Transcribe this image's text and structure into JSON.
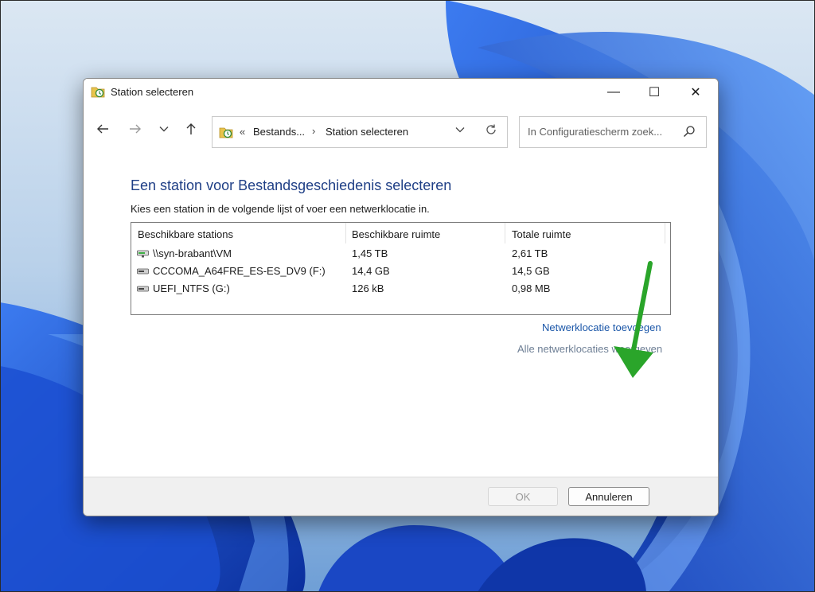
{
  "window": {
    "title": "Station selecteren",
    "controls": {
      "minimize": "—",
      "maximize": "☐",
      "close": "✕"
    }
  },
  "navigation": {
    "back_icon": "arrow-left",
    "forward_icon": "arrow-right",
    "recent_icon": "chevron-down",
    "up_icon": "arrow-up",
    "address": {
      "overflow": "«",
      "crumbs": [
        "Bestands...",
        "Station selecteren"
      ],
      "separator": "›"
    },
    "search": {
      "placeholder": "In Configuratiescherm zoek..."
    }
  },
  "content": {
    "heading": "Een station voor Bestandsgeschiedenis selecteren",
    "instruction": "Kies een station in de volgende lijst of voer een netwerklocatie in.",
    "columns": [
      "Beschikbare stations",
      "Beschikbare ruimte",
      "Totale ruimte"
    ],
    "drives": [
      {
        "name": "\\\\syn-brabant\\VM",
        "available": "1,45 TB",
        "total": "2,61 TB",
        "icon": "network-drive-icon"
      },
      {
        "name": "CCCOMA_A64FRE_ES-ES_DV9 (F:)",
        "available": "14,4 GB",
        "total": "14,5 GB",
        "icon": "drive-icon"
      },
      {
        "name": "UEFI_NTFS (G:)",
        "available": "126 kB",
        "total": "0,98 MB",
        "icon": "drive-icon"
      }
    ],
    "links": {
      "add_network": "Netwerklocatie toevoegen",
      "show_all": "Alle netwerklocaties weergeven"
    }
  },
  "footer": {
    "ok": "OK",
    "cancel": "Annuleren"
  },
  "colors": {
    "heading": "#1f3f86",
    "link": "#1a56a8",
    "annotation_arrow": "#2aa52a"
  }
}
